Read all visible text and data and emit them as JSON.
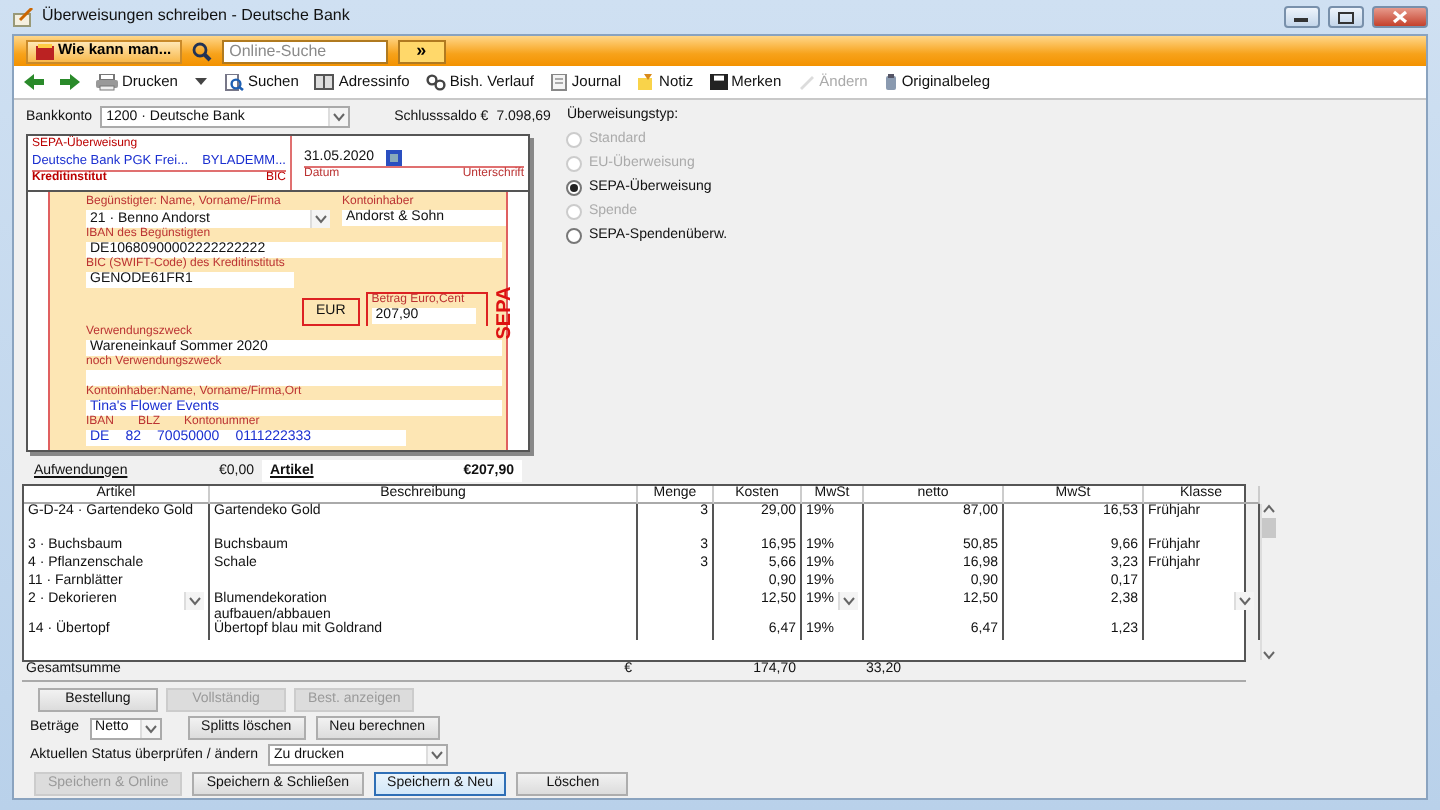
{
  "window": {
    "title": "Überweisungen schreiben - Deutsche Bank"
  },
  "helpbar": {
    "help_button": "Wie kann man...",
    "search": {
      "placeholder": "Online-Suche"
    },
    "go_button": "»"
  },
  "toolbar": [
    {
      "kind": "back",
      "disabled": false
    },
    {
      "kind": "forward",
      "disabled": false
    },
    {
      "kind": "print",
      "label": "Drucken",
      "disabled": false
    },
    {
      "kind": "caret",
      "disabled": false
    },
    {
      "kind": "search",
      "label": "Suchen",
      "disabled": false
    },
    {
      "kind": "address",
      "label": "Adressinfo",
      "disabled": false
    },
    {
      "kind": "history",
      "label": "Bish. Verlauf",
      "disabled": false
    },
    {
      "kind": "journal",
      "label": "Journal",
      "disabled": false
    },
    {
      "kind": "note",
      "label": "Notiz",
      "disabled": false
    },
    {
      "kind": "save",
      "label": "Merken",
      "disabled": false
    },
    {
      "kind": "edit",
      "label": "Ändern",
      "disabled": true
    },
    {
      "kind": "document",
      "label": "Originalbeleg",
      "disabled": false
    }
  ],
  "account": {
    "label": "Bankkonto",
    "value": "1200 · Deutsche Bank",
    "balance_label": "Schlusssaldo €",
    "balance": "7.098,69"
  },
  "form": {
    "header": "SEPA-Überweisung",
    "bank": "Deutsche Bank PGK Frei...",
    "bic": "BYLADEMM...",
    "bank_label": "Kreditinstitut",
    "bic_label": "BIC",
    "date": "31.05.2020",
    "date_label": "Datum",
    "signature_label": "Unterschrift",
    "payee_label": "Begünstigter: Name, Vorname/Firma",
    "payee": "21 · Benno Andorst",
    "holder_label": "Kontoinhaber",
    "holder": "Andorst & Sohn",
    "iban_label": "IBAN des Begünstigten",
    "iban": "DE10680900002222222222",
    "swift_label": "BIC (SWIFT-Code) des Kreditinstituts",
    "swift": "GENODE61FR1",
    "currency": "EUR",
    "amount_label": "Betrag Euro,Cent",
    "amount": "207,90",
    "purpose_label": "Verwendungszweck",
    "purpose": "Wareneinkauf Sommer 2020",
    "purpose2_label": "noch Verwendungszweck",
    "payer_label": "Kontoinhaber:Name, Vorname/Firma,Ort",
    "payer": "Tina's Flower Events",
    "payer_account_labels": [
      "IBAN",
      "BLZ",
      "Kontonummer"
    ],
    "payer_account": [
      "DE",
      "82",
      "70050000",
      "0111222333"
    ],
    "side_label": "SEPA"
  },
  "transfer_type": {
    "label": "Überweisungstyp:",
    "options": [
      {
        "label": "Standard",
        "selected": false,
        "disabled": true
      },
      {
        "label": "EU-Überweisung",
        "selected": false,
        "disabled": true
      },
      {
        "label": "SEPA-Überweisung",
        "selected": true,
        "disabled": false
      },
      {
        "label": "Spende",
        "selected": false,
        "disabled": true
      },
      {
        "label": "SEPA-Spendenüberw.",
        "selected": false,
        "disabled": false
      }
    ]
  },
  "totals": [
    {
      "label": "Aufwendungen",
      "value": "€0,00",
      "selected": false
    },
    {
      "label": "Artikel",
      "value": "€207,90",
      "selected": true
    }
  ],
  "table": {
    "columns": [
      "Artikel",
      "Beschreibung",
      "Menge",
      "Kosten",
      "MwSt",
      "netto",
      "MwSt",
      "Klasse"
    ],
    "rows": [
      {
        "cells": [
          "G-D-24 · Gartendeko Gold",
          "Gartendeko Gold",
          "3",
          "29,00",
          "19%",
          "87,00",
          "16,53",
          "Frühjahr"
        ],
        "editing": false
      },
      {
        "cells": [
          "3 · Buchsbaum",
          "Buchsbaum",
          "3",
          "16,95",
          "19%",
          "50,85",
          "9,66",
          "Frühjahr"
        ],
        "editing": false
      },
      {
        "cells": [
          "4 · Pflanzenschale",
          "Schale",
          "3",
          "5,66",
          "19%",
          "16,98",
          "3,23",
          "Frühjahr"
        ],
        "editing": false
      },
      {
        "cells": [
          "11 · Farnblätter",
          "",
          "",
          "0,90",
          "19%",
          "0,90",
          "0,17",
          ""
        ],
        "editing": false
      },
      {
        "cells": [
          "2 · Dekorieren",
          "Blumendekoration aufbauen/abbauen",
          "",
          "12,50",
          "19%",
          "12,50",
          "2,38",
          ""
        ],
        "editing": true
      },
      {
        "cells": [
          "14 · Übertopf",
          "Übertopf blau mit Goldrand",
          "",
          "6,47",
          "19%",
          "6,47",
          "1,23",
          ""
        ],
        "editing": false
      }
    ],
    "total_row": {
      "label": "Gesamtsumme",
      "currency": "€",
      "cost": "174,70",
      "tax": "33,20"
    }
  },
  "order_buttons": [
    {
      "label": "Bestellung",
      "disabled": false
    },
    {
      "label": "Vollständig",
      "disabled": true
    },
    {
      "label": "Best. anzeigen",
      "disabled": true
    }
  ],
  "amounts": {
    "label": "Beträge",
    "value": "Netto"
  },
  "calc_buttons": [
    {
      "label": "Splitts löschen",
      "disabled": false
    },
    {
      "label": "Neu berechnen",
      "disabled": false
    }
  ],
  "status": {
    "label": "Aktuellen Status überprüfen / ändern",
    "value": "Zu drucken"
  },
  "action_buttons": [
    {
      "label": "Speichern & Online",
      "disabled": true,
      "focused": false
    },
    {
      "label": "Speichern & Schließen",
      "disabled": false,
      "focused": false
    },
    {
      "label": "Speichern & Neu",
      "disabled": false,
      "focused": true
    },
    {
      "label": "Löschen",
      "disabled": false,
      "focused": false
    }
  ]
}
